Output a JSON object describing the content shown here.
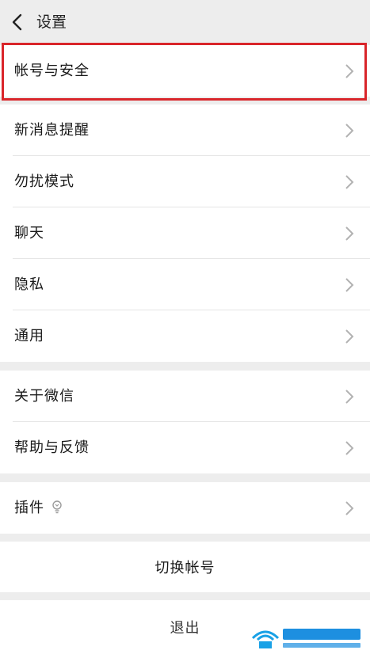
{
  "header": {
    "title": "设置"
  },
  "section1": {
    "items": [
      {
        "label": "帐号与安全"
      }
    ]
  },
  "section2": {
    "items": [
      {
        "label": "新消息提醒"
      },
      {
        "label": "勿扰模式"
      },
      {
        "label": "聊天"
      },
      {
        "label": "隐私"
      },
      {
        "label": "通用"
      }
    ]
  },
  "section3": {
    "items": [
      {
        "label": "关于微信"
      },
      {
        "label": "帮助与反馈"
      }
    ]
  },
  "section4": {
    "items": [
      {
        "label": "插件"
      }
    ]
  },
  "switch_account": {
    "label": "切换帐号"
  },
  "logout": {
    "label": "退出"
  },
  "colors": {
    "highlight": "#d9252a",
    "background": "#ededed"
  },
  "icons": {
    "back": "chevron-left-icon",
    "row": "chevron-right-icon",
    "plugin": "plugin-bulb-icon"
  }
}
